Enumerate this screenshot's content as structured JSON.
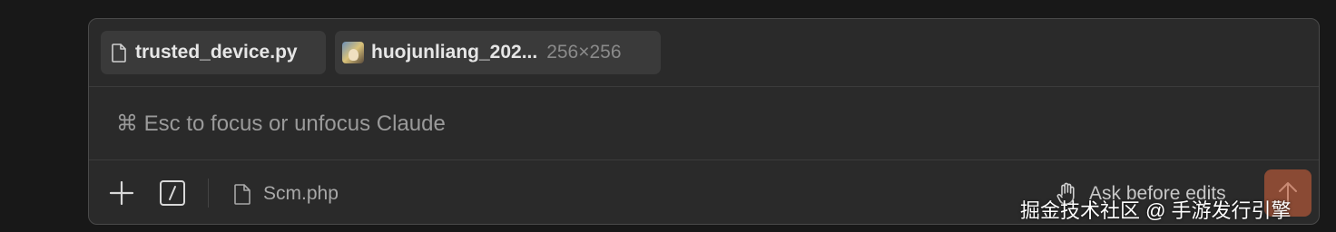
{
  "attachments": [
    {
      "name": "trusted_device.py",
      "icon": "file-icon"
    },
    {
      "name": "huojunliang_202...",
      "dims": "256×256",
      "icon": "image-thumbnail"
    }
  ],
  "prompt": {
    "placeholder": "⌘ Esc to focus or unfocus Claude",
    "value": ""
  },
  "toolbar": {
    "add_icon": "plus-icon",
    "slash_icon": "slash-command-icon",
    "context_file": "Scm.php",
    "mode_label": "Ask before edits",
    "send_icon": "arrow-up-icon"
  },
  "watermark": "掘金技术社区 @ 手游发行引擎",
  "colors": {
    "background": "#181818",
    "panel": "#2a2a2a",
    "chip": "#3a3a3a",
    "send_button": "#8a4a34"
  }
}
